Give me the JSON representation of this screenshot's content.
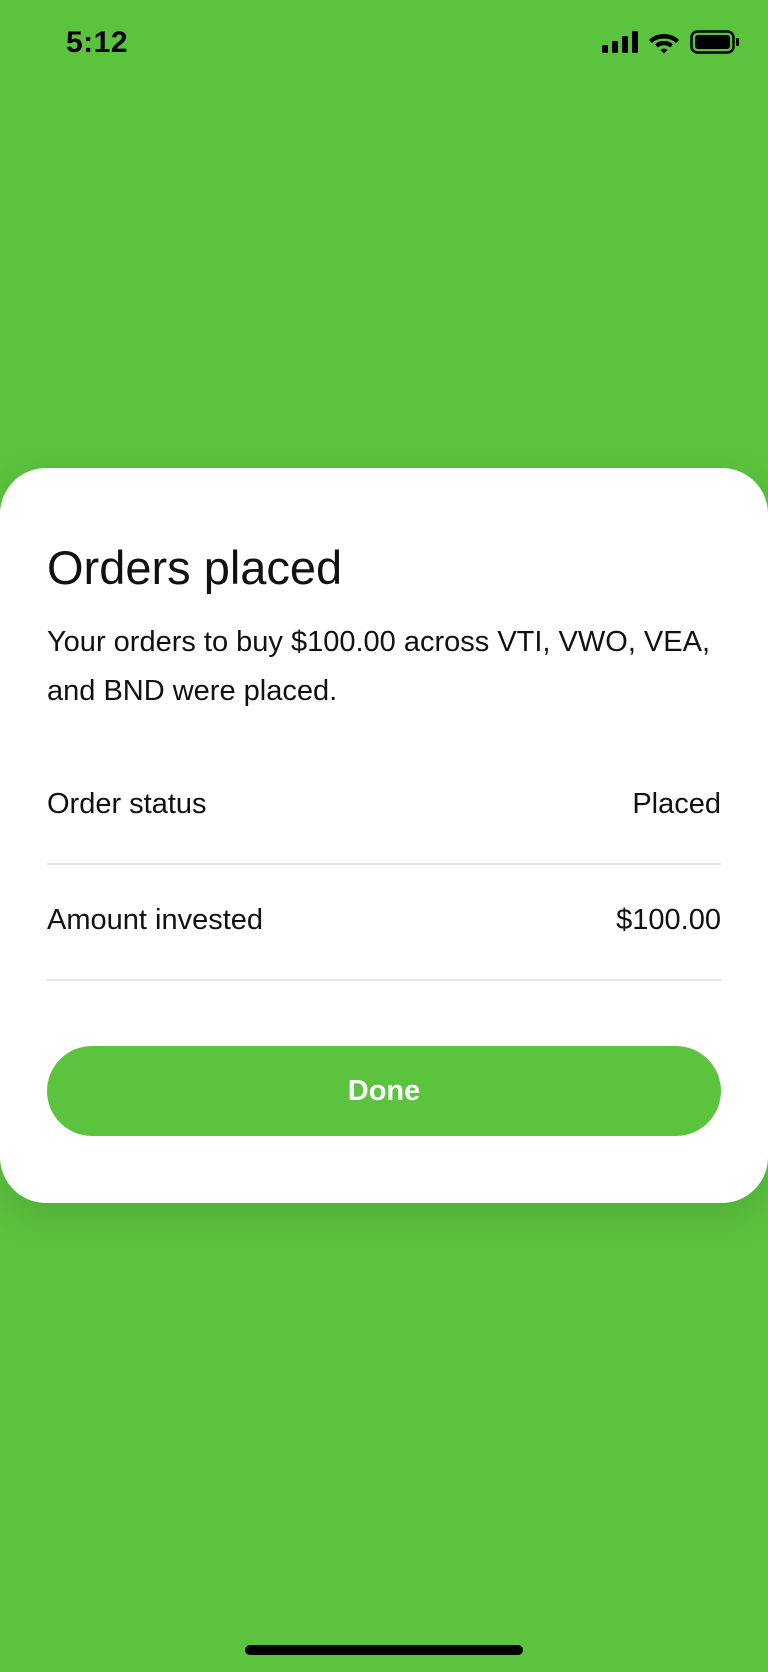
{
  "status_bar": {
    "time": "5:12",
    "icons": [
      "cellular-signal-icon",
      "wifi-icon",
      "battery-icon"
    ]
  },
  "sheet": {
    "title": "Orders placed",
    "description": "Your orders to buy $100.00 across VTI, VWO, VEA, and BND were placed.",
    "rows": [
      {
        "label": "Order status",
        "value": "Placed"
      },
      {
        "label": "Amount invested",
        "value": "$100.00"
      }
    ],
    "done_label": "Done"
  },
  "colors": {
    "accent": "#5BC33E",
    "sheet_background": "#FFFFFF",
    "text": "#111111",
    "divider": "#E6E6E6"
  }
}
